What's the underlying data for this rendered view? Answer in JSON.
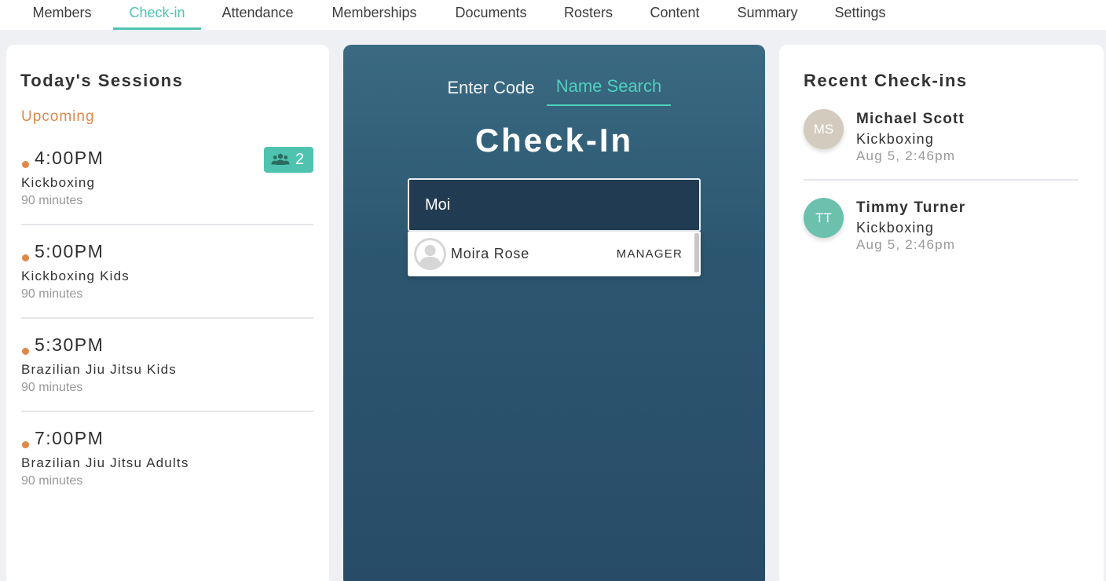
{
  "nav": {
    "tabs": [
      "Members",
      "Check-in",
      "Attendance",
      "Memberships",
      "Documents",
      "Rosters",
      "Content",
      "Summary",
      "Settings"
    ],
    "active": "Check-in"
  },
  "sessions": {
    "title": "Today's Sessions",
    "upcoming_label": "Upcoming",
    "items": [
      {
        "time": "4:00PM",
        "name": "Kickboxing",
        "duration": "90 minutes",
        "attendees": "2"
      },
      {
        "time": "5:00PM",
        "name": "Kickboxing Kids",
        "duration": "90 minutes"
      },
      {
        "time": "5:30PM",
        "name": "Brazilian Jiu Jitsu Kids",
        "duration": "90 minutes"
      },
      {
        "time": "7:00PM",
        "name": "Brazilian Jiu Jitsu Adults",
        "duration": "90 minutes"
      }
    ]
  },
  "checkin": {
    "modes": [
      "Enter Code",
      "Name Search"
    ],
    "active_mode": "Name Search",
    "title": "Check-In",
    "search_value": "Moi",
    "results": [
      {
        "name": "Moira Rose",
        "role": "MANAGER"
      }
    ]
  },
  "recent": {
    "title": "Recent Check-ins",
    "items": [
      {
        "initials": "MS",
        "name": "Michael Scott",
        "class": "Kickboxing",
        "time": "Aug 5, 2:46pm",
        "color": "#d3cbbd"
      },
      {
        "initials": "TT",
        "name": "Timmy Turner",
        "class": "Kickboxing",
        "time": "Aug 5, 2:46pm",
        "color": "#6cc1ad"
      }
    ]
  },
  "colors": {
    "accent": "#4fc3b0",
    "upcoming": "#e0884a",
    "center_bg": "#2c5670"
  },
  "icons": {
    "badge": "people-icon",
    "result_avatar": "user-placeholder-icon"
  }
}
